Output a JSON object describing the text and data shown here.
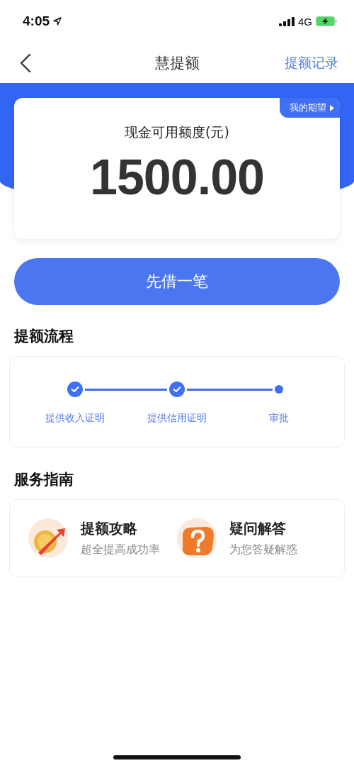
{
  "status_bar": {
    "time": "4:05",
    "network": "4G"
  },
  "nav": {
    "title": "慧提额",
    "action": "提额记录"
  },
  "quota_card": {
    "badge": "我的期望",
    "label": "现金可用额度(元)",
    "amount": "1500.00"
  },
  "primary_button": "先借一笔",
  "process": {
    "title": "提额流程",
    "steps": [
      {
        "label": "提供收入证明",
        "done": true
      },
      {
        "label": "提供信用证明",
        "done": true
      },
      {
        "label": "审批",
        "done": false
      }
    ]
  },
  "guide": {
    "title": "服务指南",
    "items": [
      {
        "kind": "coin",
        "title": "提额攻略",
        "subtitle": "超全提高成功率"
      },
      {
        "kind": "question",
        "title": "疑问解答",
        "subtitle": "为您答疑解惑"
      }
    ]
  }
}
